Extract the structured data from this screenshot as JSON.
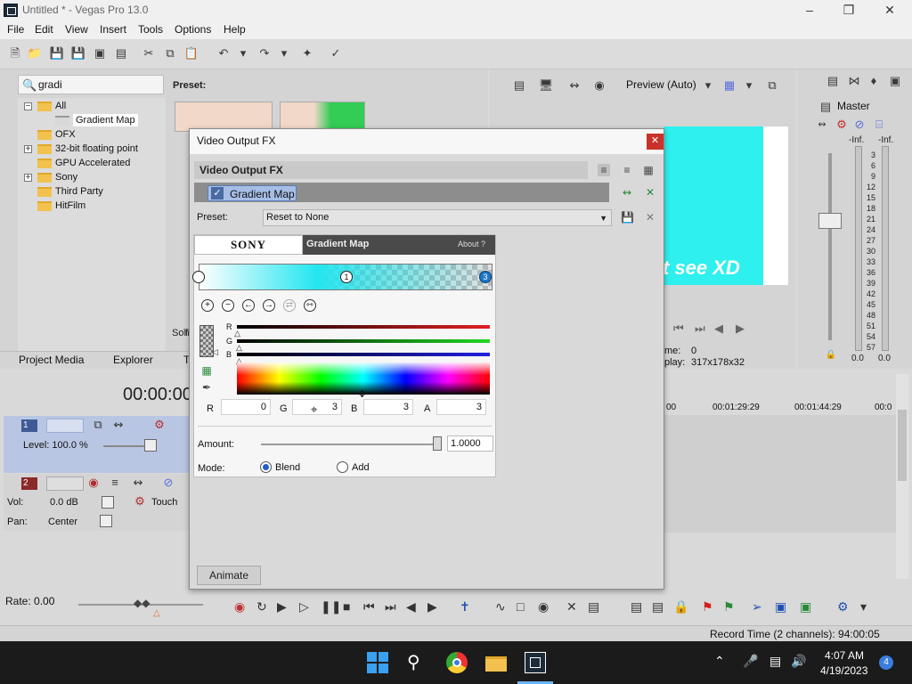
{
  "window": {
    "title": "Untitled * - Vegas Pro 13.0"
  },
  "menu": [
    "File",
    "Edit",
    "View",
    "Insert",
    "Tools",
    "Options",
    "Help"
  ],
  "explorer": {
    "search_value": "gradi",
    "preset_label": "Preset:",
    "tree": [
      "All",
      "Gradient Map",
      "OFX",
      "32-bit floating point",
      "GPU Accelerated",
      "Sony",
      "Third Party",
      "HitFilm"
    ],
    "thumb_caption_1": "Son",
    "thumb_caption_2": "T",
    "tabs": [
      "Project Media",
      "Explorer",
      "T"
    ]
  },
  "preview": {
    "mode": "Preview (Auto)",
    "overlay_text": "t see XD",
    "frame_label": "me:",
    "frame_value": "0",
    "display_label": "play:",
    "display_value": "317x178x32"
  },
  "master": {
    "label": "Master",
    "inf_left": "-Inf.",
    "inf_right": "-Inf.",
    "scale": [
      "3",
      "6",
      "9",
      "12",
      "15",
      "18",
      "21",
      "24",
      "27",
      "30",
      "33",
      "36",
      "39",
      "42",
      "45",
      "48",
      "51",
      "54",
      "57"
    ],
    "level_left": "0.0",
    "level_right": "0.0"
  },
  "timeline": {
    "time": "00:00:00",
    "ruler": [
      "00",
      "00:01:29:29",
      "00:01:44:29",
      "00:0"
    ],
    "track1": {
      "num": "1",
      "level": "Level: 100.0 %"
    },
    "track2": {
      "num": "2",
      "vol_label": "Vol:",
      "vol_value": "0.0 dB",
      "pan_label": "Pan:",
      "pan_value": "Center",
      "touch": "Touch"
    },
    "rate": "Rate: 0.00"
  },
  "status": {
    "record_time": "Record Time (2 channels): 94:00:05"
  },
  "dialog": {
    "title": "Video Output FX",
    "fx_header": "Video Output FX",
    "chain_item": "Gradient Map",
    "preset_label": "Preset:",
    "preset_value": "Reset to None",
    "plugin": {
      "brand": "SONY",
      "name": "Gradient Map",
      "about": "About  ?",
      "stops": [
        "1",
        "3"
      ],
      "channels": [
        "R",
        "G",
        "B"
      ],
      "components": [
        {
          "label": "R",
          "value": "0"
        },
        {
          "label": "G",
          "value": "3"
        },
        {
          "label": "B",
          "value": "3"
        },
        {
          "label": "A",
          "value": "3"
        }
      ],
      "amount_label": "Amount:",
      "amount_value": "1.0000",
      "amount_fraction": 0.99,
      "mode_label": "Mode:",
      "mode_options": [
        "Blend",
        "Add"
      ],
      "mode_selected": "Blend"
    },
    "animate": "Animate"
  },
  "taskbar": {
    "time": "4:07 AM",
    "date": "4/19/2023",
    "badge": "4"
  },
  "colors": {
    "accent": "#1f77c8",
    "close_red": "#c8322a",
    "track_blue": "#b9c6e3",
    "preview_cyan": "#2ef0ee"
  }
}
